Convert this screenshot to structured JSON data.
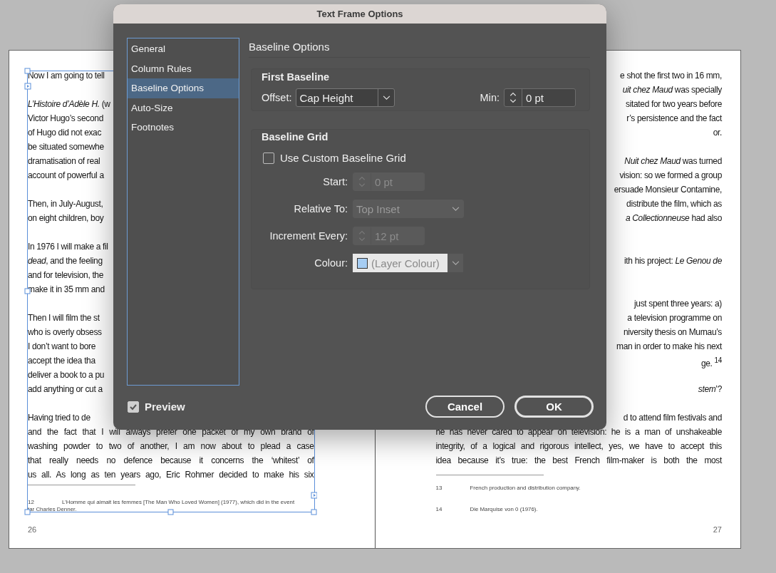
{
  "spread": {
    "pages": [
      {
        "paragraphs": [
          {
            "lines": [
              "Now I am going to tell"
            ]
          },
          {
            "lines": [
              "*L’Histoire d’Adèle H.* (w",
              "Victor Hugo’s second",
              "of Hugo did not exac",
              "be situated somewhe",
              "dramatisation of real",
              "account of powerful a"
            ]
          },
          {
            "lines": [
              "Then, in July-August,",
              "on eight children, boy"
            ]
          },
          {
            "lines": [
              "In 1976 I will make a fil",
              "*dead*, and the feeling",
              "and for television, the",
              "make it in 35 mm and"
            ]
          },
          {
            "lines": [
              "Then I will film the st",
              "who is overly obsess",
              "I don’t want to bore",
              "accept the idea tha",
              "deliver a book to a pu",
              "add anything or cut a"
            ]
          },
          {
            "lines": [
              "Having tried to de",
              "and the fact that I will always prefer one packet of my own brand of",
              "washing powder to two of another, I am now about to plead a case",
              "that really needs no defence because it concerns the ‘whitest’ of",
              "us all. As long as ten years ago, Eric Rohmer decided to make his six"
            ]
          }
        ],
        "footnotes": [
          {
            "number": "12",
            "lines": [
              "L’Homme qui aimait les femmes [The Man Who Loved Women] (1977), which did in the event",
              "tar Charles Denner."
            ]
          }
        ],
        "page_number": "26"
      },
      {
        "paragraphs": [
          {
            "lines": [
              "e shot the first two in 16 mm,",
              "*uit chez Maud* was specially",
              "sitated for two years before",
              "r’s persistence and the fact",
              "or."
            ]
          },
          {
            "lines": [
              "*Nuit chez Maud* was turned",
              "vision: so we formed a group",
              "ersuade Monsieur Contamine,",
              "distribute the film, which as",
              "*a Collectionneuse* had also"
            ]
          },
          {
            "lines": [
              "ith his project: *Le Genou de*"
            ]
          },
          {
            "lines": [
              "just spent three years: a)",
              "a television programme on",
              "niversity thesis on Murnau’s",
              "man in order to make his next",
              "ge. $^{14}$"
            ]
          },
          {
            "lines": [
              "*stem*’?"
            ]
          },
          {
            "lines": [
              "d to attend film festivals and",
              "he has never cared to appear on television: he is a man of unshakeable",
              "integrity, of a logical and rigorous intellect, yes, we have to accept this",
              "idea because it’s true: the best French film-maker is both the most"
            ]
          }
        ],
        "footnotes": [
          {
            "number": "13",
            "lines": [
              "French production and distribution company."
            ]
          },
          {
            "number": "14",
            "lines": [
              "Die Marquise von 0 (1976)."
            ]
          }
        ],
        "page_number": "27"
      }
    ]
  },
  "dialog": {
    "title": "Text Frame Options",
    "sidebar": [
      {
        "label": "General",
        "selected": false
      },
      {
        "label": "Column Rules",
        "selected": false
      },
      {
        "label": "Baseline Options",
        "selected": true
      },
      {
        "label": "Auto-Size",
        "selected": false
      },
      {
        "label": "Footnotes",
        "selected": false
      }
    ],
    "heading": "Baseline Options",
    "groups": [
      {
        "title": "First Baseline",
        "fields": [
          {
            "label": "Offset:",
            "kind": "dropdown",
            "value": "Cap Height",
            "disabled": false
          },
          {
            "label": "Min:",
            "kind": "spinner",
            "value": "0 pt",
            "disabled": false
          }
        ]
      },
      {
        "title": "Baseline Grid",
        "checkbox": {
          "label": "Use Custom Baseline Grid",
          "checked": false
        },
        "fields": [
          {
            "label": "Start:",
            "kind": "spinner",
            "value": "0 pt",
            "disabled": true
          },
          {
            "label": "Relative To:",
            "kind": "dropdown",
            "value": "Top Inset",
            "disabled": true
          },
          {
            "label": "Increment Every:",
            "kind": "spinner",
            "value": "12 pt",
            "disabled": true
          },
          {
            "label": "Colour:",
            "kind": "swatch",
            "value": "(Layer Colour)",
            "disabled": true
          }
        ]
      }
    ],
    "preview": {
      "label": "Preview",
      "checked": true
    },
    "buttons": [
      {
        "label": "Cancel",
        "default": false
      },
      {
        "label": "OK",
        "default": true
      }
    ]
  }
}
